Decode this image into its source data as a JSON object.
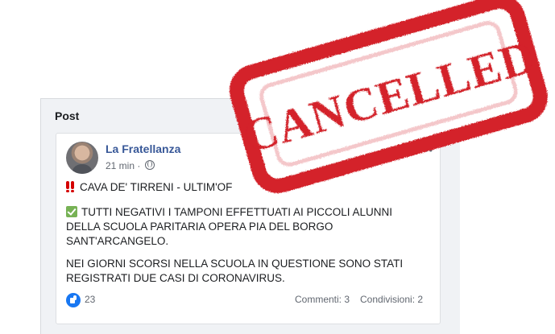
{
  "panel": {
    "title": "Post"
  },
  "post": {
    "author": "La Fratellanza",
    "time": "21 min ·",
    "line1": "CAVA DE' TIRRENI - ULTIM'OF",
    "paragraph1": "TUTTI NEGATIVI I TAMPONI EFFETTUATI AI PICCOLI ALUNNI DELLA SCUOLA PARITARIA OPERA PIA DEL BORGO SANT'ARCANGELO.",
    "paragraph2": "NEI GIORNI SCORSI NELLA SCUOLA IN QUESTIONE SONO STATI REGISTRATI DUE CASI DI CORONAVIRUS.",
    "reactions": "23",
    "comments": "Commenti: 3",
    "shares": "Condivisioni: 2"
  },
  "stamp": {
    "text": "CANCELLED",
    "color": "#d4202a"
  },
  "icons": [
    "globe-icon",
    "double-exclamation-icon",
    "check-mark-icon",
    "like-icon",
    "more-options-icon"
  ]
}
